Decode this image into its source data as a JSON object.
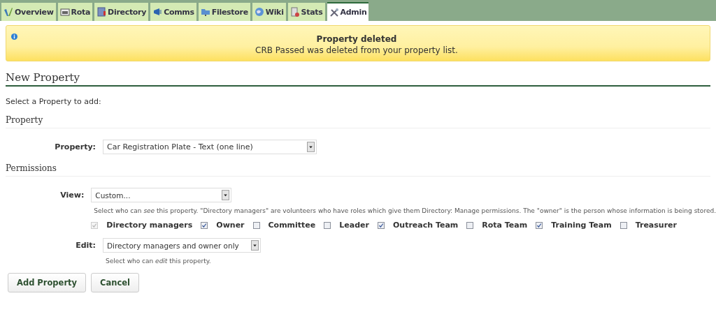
{
  "tabs": [
    {
      "label": "Overview",
      "selected": false
    },
    {
      "label": "Rota",
      "selected": false
    },
    {
      "label": "Directory",
      "selected": false
    },
    {
      "label": "Comms",
      "selected": false
    },
    {
      "label": "Filestore",
      "selected": false
    },
    {
      "label": "Wiki",
      "selected": false
    },
    {
      "label": "Stats",
      "selected": false
    },
    {
      "label": "Admin",
      "selected": true
    }
  ],
  "notice": {
    "title": "Property deleted",
    "message": "CRB Passed was deleted from your property list."
  },
  "heading": "New Property",
  "intro": "Select a Property to add:",
  "property_section": {
    "title": "Property",
    "label": "Property:",
    "value": "Car Registration Plate - Text (one line)"
  },
  "permissions_section": {
    "title": "Permissions",
    "view": {
      "label": "View:",
      "value": "Custom...",
      "help": "Select who can *see* this property. \"Directory managers\" are volunteers who have roles which give them Directory: Manage permissions. The \"owner\" is the person whose information is being stored.",
      "options": [
        {
          "label": "Directory managers",
          "checked": true,
          "disabled": true
        },
        {
          "label": "Owner",
          "checked": true,
          "disabled": false
        },
        {
          "label": "Committee",
          "checked": false,
          "disabled": false
        },
        {
          "label": "Leader",
          "checked": false,
          "disabled": false
        },
        {
          "label": "Outreach Team",
          "checked": true,
          "disabled": false
        },
        {
          "label": "Rota Team",
          "checked": false,
          "disabled": false
        },
        {
          "label": "Training Team",
          "checked": true,
          "disabled": false
        },
        {
          "label": "Treasurer",
          "checked": false,
          "disabled": false
        }
      ]
    },
    "edit": {
      "label": "Edit:",
      "value": "Directory managers and owner only",
      "help": "Select who can *edit* this property."
    }
  },
  "buttons": [
    "Add Property",
    "Cancel"
  ]
}
